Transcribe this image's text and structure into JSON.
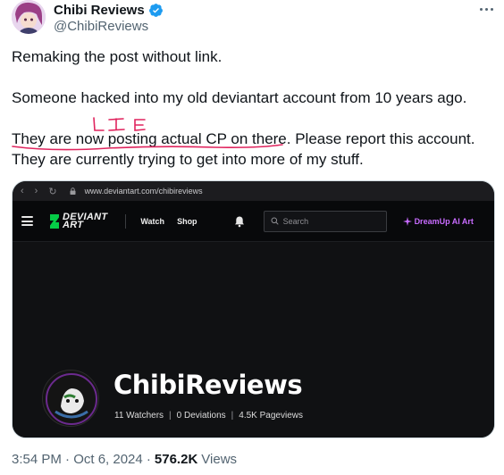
{
  "author": {
    "display_name": "Chibi Reviews",
    "handle": "@ChibiReviews"
  },
  "tweet": {
    "line1": "Remaking the post without link.",
    "line2": "Someone hacked into my old deviantart account from 10 years ago.",
    "line3_underlined": "They are now posting actual CP on there",
    "line3_rest": ". Please report this account.",
    "line4": "They are currently trying to get into more of my stuff.",
    "annotation": "LIE"
  },
  "screenshot": {
    "url": "www.deviantart.com/chibireviews",
    "logo_line1": "DEVIANT",
    "logo_line2": "ART",
    "nav_watch": "Watch",
    "nav_shop": "Shop",
    "search_placeholder": "Search",
    "dreamup": "DreamUp AI Art",
    "profile_name": "ChibiReviews",
    "watchers": "11 Watchers",
    "deviations": "0 Deviations",
    "pageviews": "4.5K Pageviews"
  },
  "footer": {
    "timestamp": "3:54 PM · Oct 6, 2024 ·",
    "views_count": "576.2K",
    "views_label": "Views"
  },
  "colors": {
    "verified": "#1d9bf0",
    "annotation": "#e0245e",
    "secondary_text": "#536471",
    "dreamup": "#c86bff"
  }
}
